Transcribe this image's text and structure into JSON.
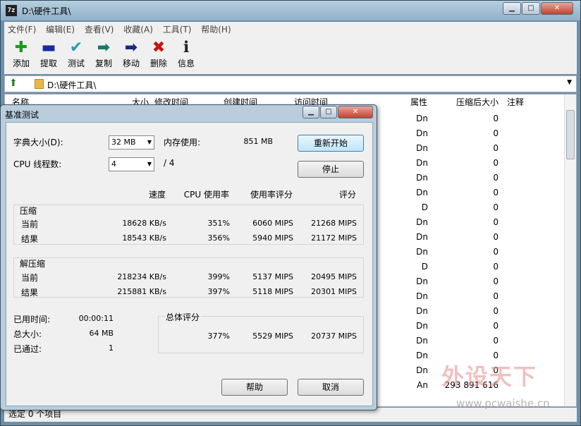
{
  "window": {
    "title": "D:\\硬件工具\\",
    "app_icon": "7z",
    "min": "▁",
    "max": "□",
    "close": "✕"
  },
  "menu": [
    "文件(F)",
    "编辑(E)",
    "查看(V)",
    "收藏(A)",
    "工具(T)",
    "帮助(H)"
  ],
  "toolbar": [
    {
      "label": "添加",
      "icon": "plus-icon",
      "glyph": "✚",
      "color": "#1a9a1a"
    },
    {
      "label": "提取",
      "icon": "minus-icon",
      "glyph": "▬",
      "color": "#1a2aa0"
    },
    {
      "label": "测试",
      "icon": "check-icon",
      "glyph": "✔",
      "color": "#2a9ab0"
    },
    {
      "label": "复制",
      "icon": "copy-arrow-icon",
      "glyph": "➡",
      "color": "#1a7a6a"
    },
    {
      "label": "移动",
      "icon": "move-arrow-icon",
      "glyph": "➡",
      "color": "#1a2a80"
    },
    {
      "label": "删除",
      "icon": "delete-icon",
      "glyph": "✖",
      "color": "#cc1111"
    },
    {
      "label": "信息",
      "icon": "info-icon",
      "glyph": "ℹ",
      "color": "#222222"
    }
  ],
  "address": {
    "path": "D:\\硬件工具\\"
  },
  "list": {
    "headers": [
      "名称",
      "大小",
      "修改时间",
      "创建时间",
      "访问时间",
      "属性",
      "压缩后大小",
      "注释"
    ],
    "rows": [
      {
        "attr": "Dn",
        "csize": "0"
      },
      {
        "attr": "Dn",
        "csize": "0"
      },
      {
        "attr": "Dn",
        "csize": "0"
      },
      {
        "attr": "Dn",
        "csize": "0"
      },
      {
        "attr": "Dn",
        "csize": "0"
      },
      {
        "attr": "Dn",
        "csize": "0"
      },
      {
        "attr": "D",
        "csize": "0"
      },
      {
        "attr": "Dn",
        "csize": "0"
      },
      {
        "attr": "Dn",
        "csize": "0"
      },
      {
        "attr": "Dn",
        "csize": "0"
      },
      {
        "attr": "D",
        "csize": "0"
      },
      {
        "attr": "Dn",
        "csize": "0"
      },
      {
        "attr": "Dn",
        "csize": "0"
      },
      {
        "attr": "Dn",
        "csize": "0"
      },
      {
        "attr": "Dn",
        "csize": "0"
      },
      {
        "attr": "Dn",
        "csize": "0"
      },
      {
        "attr": "Dn",
        "csize": "0"
      },
      {
        "attr": "Dn",
        "csize": "0"
      },
      {
        "attr": "An",
        "csize": "293 891 616"
      }
    ]
  },
  "status": "选定 0 个项目",
  "watermark": {
    "big": "外设天下",
    "small": "www.pcwaishe.cn"
  },
  "dialog": {
    "title": "基准测试",
    "dict_label": "字典大小(D):",
    "dict_value": "32 MB",
    "mem_label": "内存使用:",
    "mem_value": "851 MB",
    "threads_label": "CPU 线程数:",
    "threads_value": "4",
    "threads_total": "/ 4",
    "restart": "重新开始",
    "stop": "停止",
    "col_speed": "速度",
    "col_cpu": "CPU 使用率",
    "col_rating_usage": "使用率评分",
    "col_rating": "评分",
    "compress": {
      "title": "压缩",
      "current": {
        "label": "当前",
        "speed": "18628 KB/s",
        "cpu": "351%",
        "usage": "6060 MIPS",
        "rating": "21268 MIPS"
      },
      "result": {
        "label": "结果",
        "speed": "18543 KB/s",
        "cpu": "356%",
        "usage": "5940 MIPS",
        "rating": "21172 MIPS"
      }
    },
    "decompress": {
      "title": "解压缩",
      "current": {
        "label": "当前",
        "speed": "218234 KB/s",
        "cpu": "399%",
        "usage": "5137 MIPS",
        "rating": "20495 MIPS"
      },
      "result": {
        "label": "结果",
        "speed": "215881 KB/s",
        "cpu": "397%",
        "usage": "5118 MIPS",
        "rating": "20301 MIPS"
      }
    },
    "elapsed_label": "已用时间:",
    "elapsed": "00:00:11",
    "size_label": "总大小:",
    "size": "64 MB",
    "passes_label": "已通过:",
    "passes": "1",
    "total_title": "总体评分",
    "total": {
      "cpu": "377%",
      "usage": "5529 MIPS",
      "rating": "20737 MIPS"
    },
    "help": "帮助",
    "cancel": "取消"
  }
}
